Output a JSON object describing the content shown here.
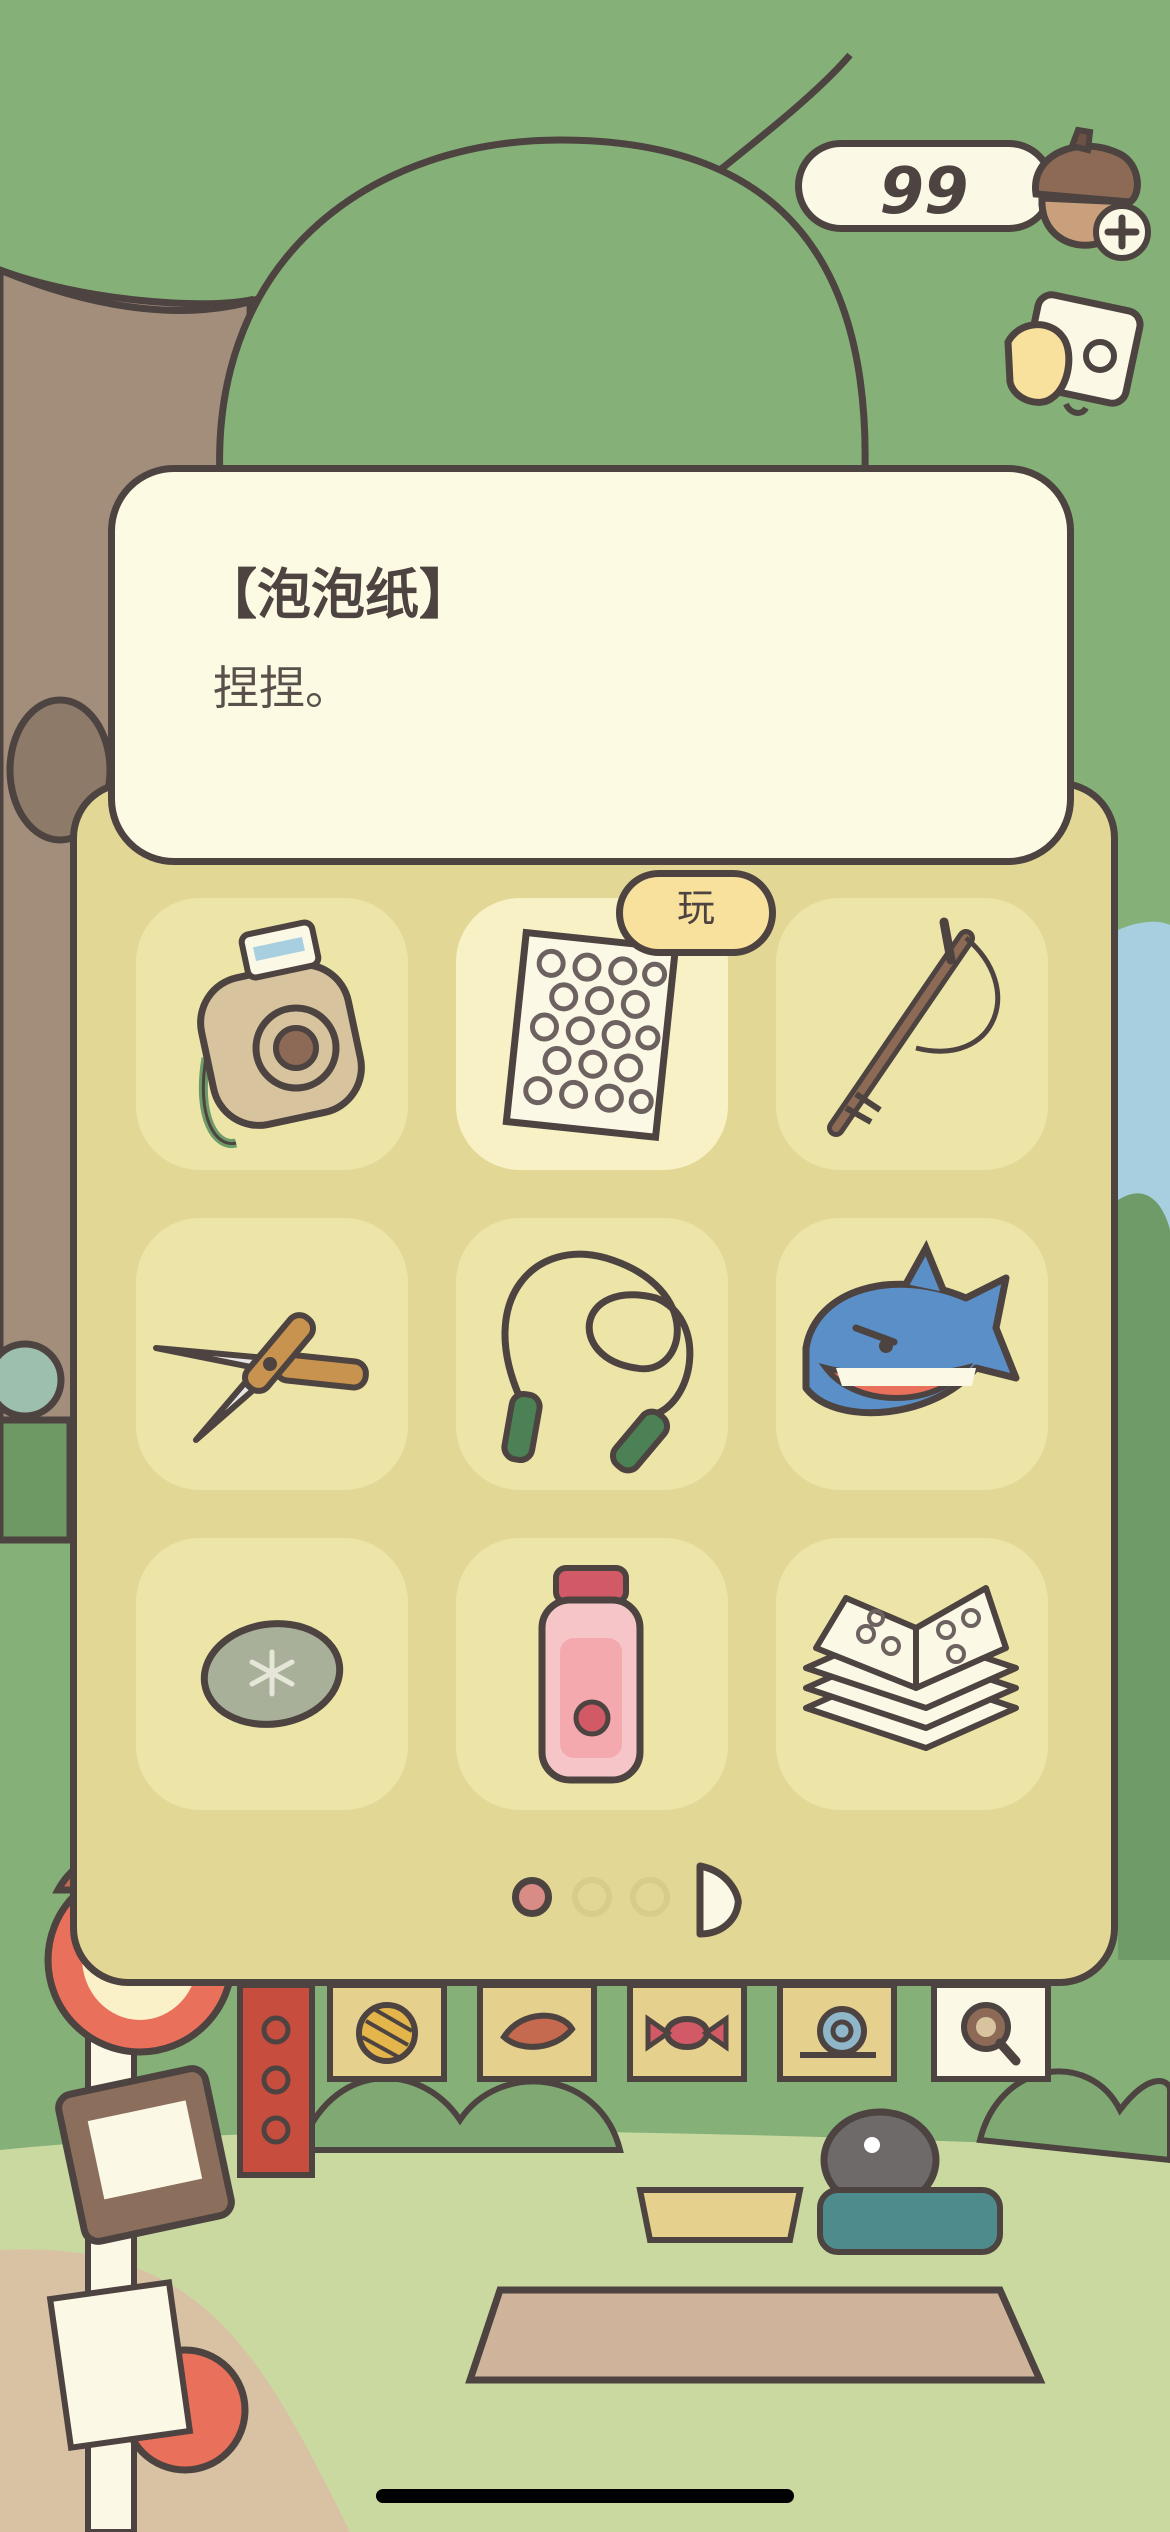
{
  "currency": {
    "amount": "99",
    "icon": "acorn-icon",
    "add_icon": "plus-icon"
  },
  "item_detail": {
    "title": "【泡泡纸】",
    "description": "捏捏。"
  },
  "selected_action": {
    "label": "玩"
  },
  "items": [
    {
      "name": "instant-camera",
      "icon": "camera-icon"
    },
    {
      "name": "bubble-wrap",
      "icon": "bubble-wrap-icon",
      "selected": true
    },
    {
      "name": "branch",
      "icon": "branch-icon"
    },
    {
      "name": "pruning-shears",
      "icon": "shears-icon"
    },
    {
      "name": "jump-rope",
      "icon": "jump-rope-icon"
    },
    {
      "name": "shark-toy",
      "icon": "shark-icon"
    },
    {
      "name": "stone",
      "icon": "stone-icon"
    },
    {
      "name": "water-bottle",
      "icon": "bottle-icon"
    },
    {
      "name": "bubble-wrap-stack",
      "icon": "bubble-wrap-stack-icon"
    }
  ],
  "pagination": {
    "total_pages": 3,
    "current_page": 1
  },
  "category_tabs": [
    "yarn-ball-icon",
    "leaf-icon",
    "candy-icon",
    "snail-icon",
    "magnifier-icon"
  ],
  "colors": {
    "outline": "#4d4340",
    "panel": "#e2d794",
    "card": "#fdfae3",
    "slot": "#ede4a8",
    "slot_selected": "#f8f1c6",
    "grass": "#85b078",
    "button": "#f8e19c",
    "active_dot": "#d98b86"
  }
}
